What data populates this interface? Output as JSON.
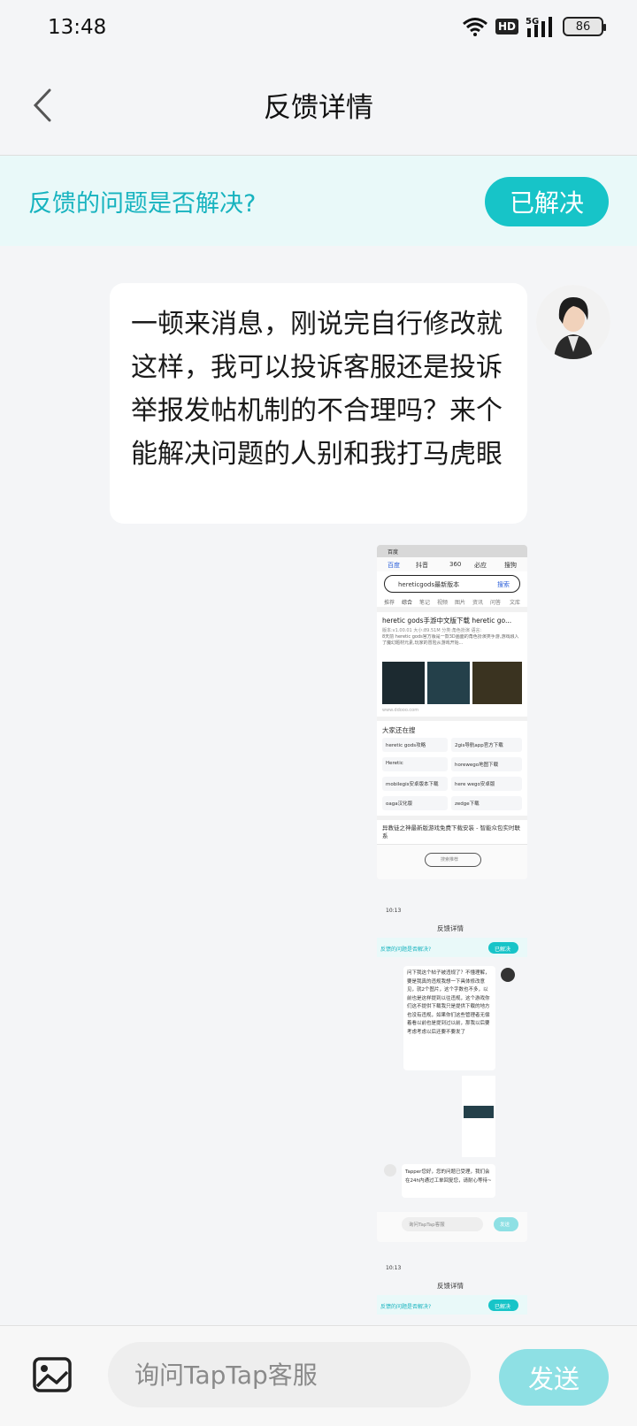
{
  "status_bar": {
    "time": "13:48",
    "network": "5G",
    "hd": "HD",
    "battery": "86"
  },
  "header": {
    "title": "反馈详情"
  },
  "resolution": {
    "question": "反馈的问题是否解决?",
    "button": "已解决"
  },
  "message": {
    "text": "一顿来消息，刚说完自行修改就这样，我可以投诉客服还是投诉举报发帖机制的不合理吗？来个能解决问题的人别和我打马虎眼"
  },
  "attachment1": {
    "tabs": [
      "百度",
      "抖音",
      "360",
      "必应",
      "搜狗"
    ],
    "search_query": "hereticgods最新版本",
    "search_button": "搜索",
    "filters": [
      "推荐",
      "综合",
      "笔记",
      "视频",
      "图片",
      "资讯",
      "问答",
      "文库"
    ],
    "result_title": "heretic gods手游中文版下载 heretic go...",
    "result_meta": "版本:v1.00.01  大小:89.51M  分类:角色扮演  语言:",
    "result_desc": "8天前 heretic gods官方版是一款3D画面的角色扮演类手游,游戏融入了魔幻题材元素,玩家的冒险从游戏开始...",
    "result_source": "www.ddooo.com",
    "related_title": "大家还在搜",
    "related": [
      "heretic gods攻略",
      "2gis导航app官方下载",
      "Heretic",
      "horewego地图下载",
      "mobilegis安卓版本下载",
      "here wego安卓版",
      "oaga汉化版",
      "zedge下载"
    ],
    "result2_title": "异教徒之神最新版游戏免费下载安装 - 智能众包实时联系",
    "home_label": "搜索推荐"
  },
  "attachment2": {
    "time": "10:13",
    "title": "反馈详情",
    "question": "反馈的问题是否解决?",
    "button": "已解决",
    "message": "问下我这个帖子被违规了？不懂理解，要是我真的违规我想一下具体修改意见，就2个图片，这个字数也不多，以前也是这样提到以往违规，这个游戏你们这不提供下载我只是提供下载的地方也没有违规，如果你们这些管理者无偿着看以前也是提到过以前，那我以后要考虑考虑以后还要不要发了",
    "reply": "Tapper您好，您的问题已受理，我们会在24h内通过工单回复您，请耐心等待~",
    "placeholder": "询问TapTap客服",
    "send": "发送"
  },
  "attachment3": {
    "time": "10:13",
    "title": "反馈详情",
    "question": "反馈的问题是否解决?",
    "button": "已解决"
  },
  "composer": {
    "placeholder": "询问TapTap客服",
    "send": "发送"
  }
}
